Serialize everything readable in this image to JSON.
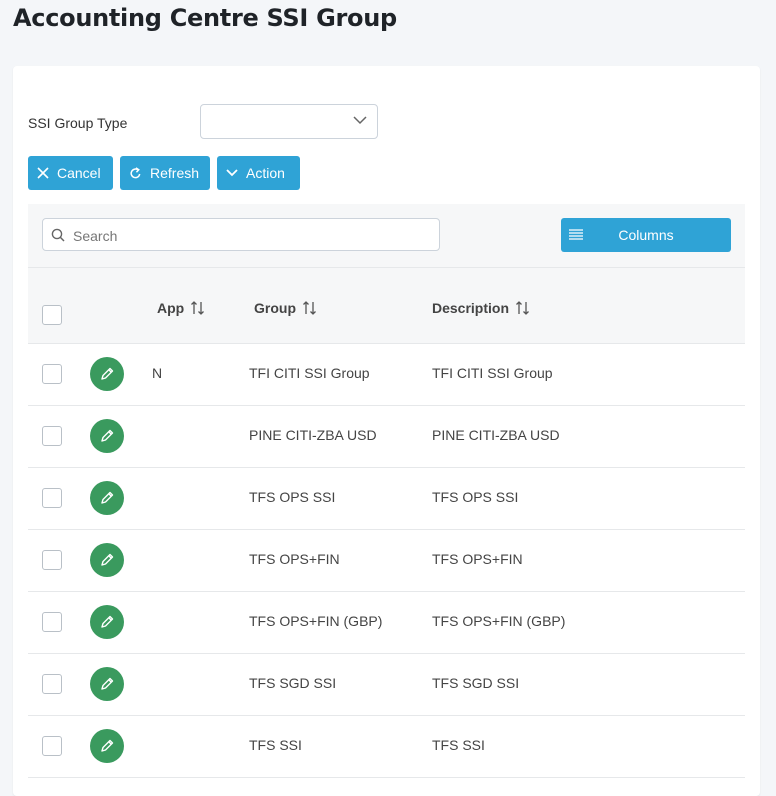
{
  "page": {
    "title": "Accounting Centre SSI Group"
  },
  "filter": {
    "label": "SSI Group Type",
    "selected": ""
  },
  "buttons": {
    "cancel": "Cancel",
    "refresh": "Refresh",
    "action": "Action"
  },
  "toolbar": {
    "search_placeholder": "Search",
    "search_value": "",
    "columns_label": "Columns"
  },
  "table": {
    "headers": {
      "app": "App",
      "group": "Group",
      "description": "Description"
    },
    "rows": [
      {
        "app": "N",
        "group": "TFI CITI SSI Group",
        "description": "TFI CITI SSI Group"
      },
      {
        "app": "",
        "group": "PINE CITI-ZBA USD",
        "description": "PINE CITI-ZBA USD"
      },
      {
        "app": "",
        "group": "TFS OPS SSI",
        "description": "TFS OPS SSI"
      },
      {
        "app": "",
        "group": "TFS OPS+FIN",
        "description": "TFS OPS+FIN"
      },
      {
        "app": "",
        "group": "TFS OPS+FIN (GBP)",
        "description": "TFS OPS+FIN (GBP)"
      },
      {
        "app": "",
        "group": "TFS SGD SSI",
        "description": "TFS SGD SSI"
      },
      {
        "app": "",
        "group": "TFS SSI",
        "description": "TFS SSI"
      }
    ]
  },
  "icons": {
    "cancel": "close-icon",
    "refresh": "refresh-icon",
    "action": "chevron-down-icon",
    "search": "search-icon",
    "columns": "list-icon",
    "sort": "sort-icon",
    "edit": "pencil-icon"
  },
  "colors": {
    "primary": "#2fa3d6",
    "edit_button": "#3a9a5e",
    "background": "#f4f6f9"
  }
}
